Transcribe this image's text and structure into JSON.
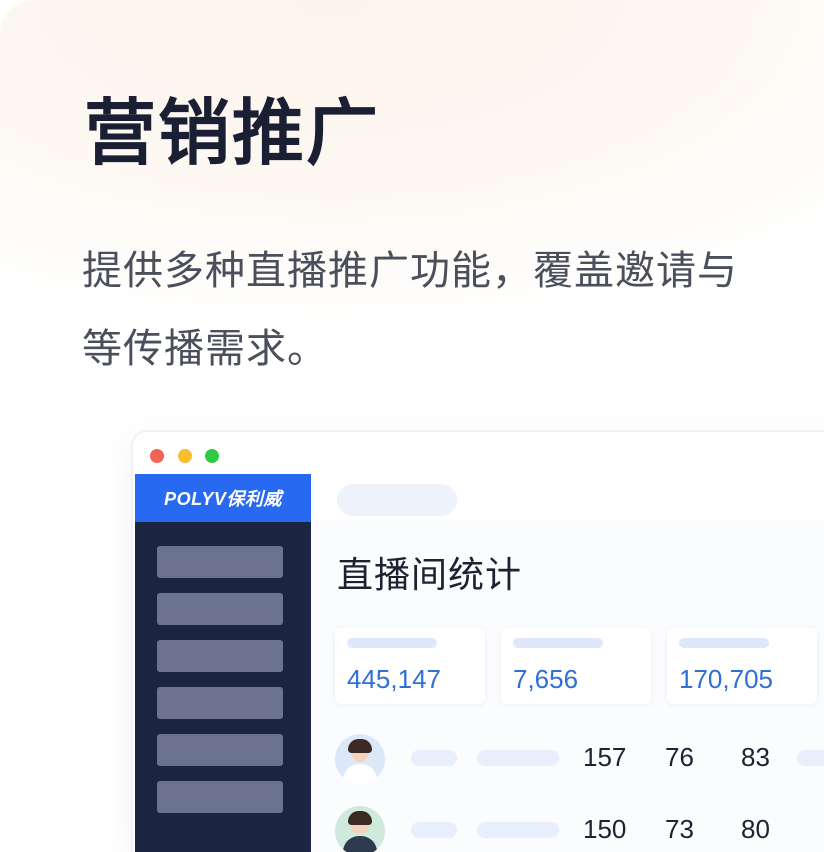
{
  "header": {
    "title": "营销推广",
    "description_lines": [
      "提供多种直播推广功能，覆盖邀请与",
      "等传播需求。"
    ]
  },
  "window": {
    "logo": "POLYV保利威",
    "sidebar_item_count": 6,
    "section_title": "直播间统计",
    "stats": [
      {
        "value": "445,147"
      },
      {
        "value": "7,656"
      },
      {
        "value": "170,705"
      }
    ],
    "rows": [
      {
        "values": [
          "157",
          "76",
          "83"
        ]
      },
      {
        "values": [
          "150",
          "73",
          "80"
        ]
      }
    ]
  },
  "colors": {
    "accent": "#2769f0",
    "sidebar": "#1b2441",
    "stat_value": "#2e6fd8"
  }
}
